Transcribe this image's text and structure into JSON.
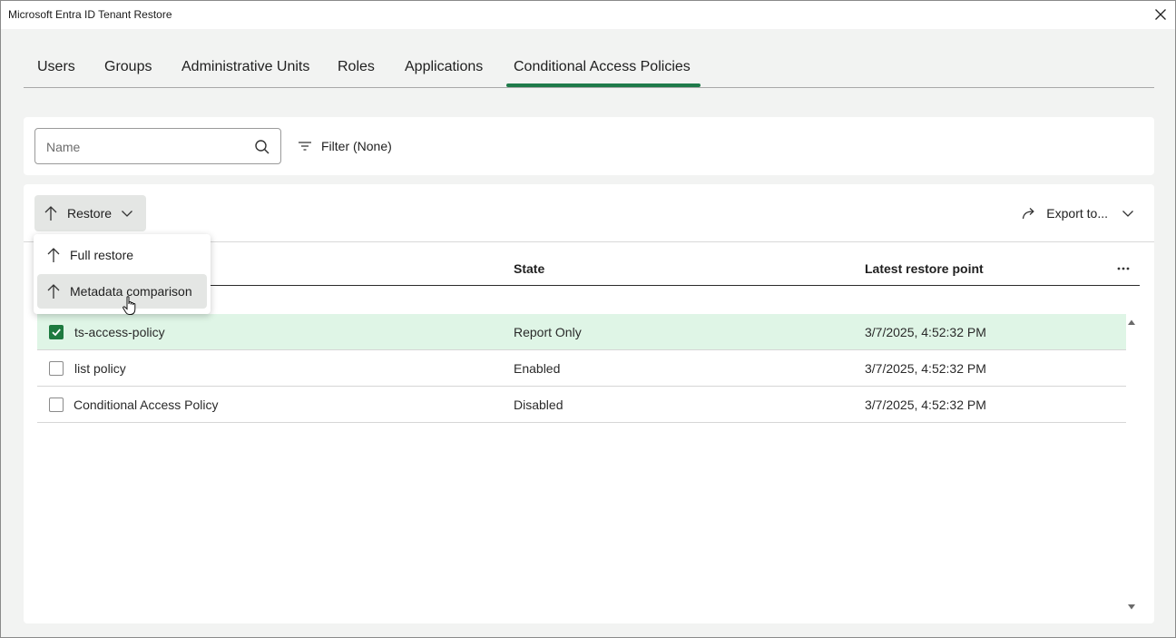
{
  "window": {
    "title": "Microsoft Entra ID Tenant Restore"
  },
  "tabs": [
    {
      "label": "Users"
    },
    {
      "label": "Groups"
    },
    {
      "label": "Administrative Units"
    },
    {
      "label": "Roles"
    },
    {
      "label": "Applications"
    },
    {
      "label": "Conditional Access Policies",
      "active": true
    }
  ],
  "search": {
    "placeholder": "Name",
    "value": ""
  },
  "filter": {
    "label": "Filter (None)"
  },
  "toolbar": {
    "restore_label": "Restore",
    "export_label": "Export to..."
  },
  "restore_menu": [
    {
      "label": "Full restore",
      "icon": "arrow-up-icon"
    },
    {
      "label": "Metadata comparison",
      "icon": "arrow-up-icon",
      "hovered": true
    }
  ],
  "table": {
    "columns": [
      "State",
      "Latest restore point"
    ],
    "rows": [
      {
        "checked": true,
        "name": "ts-access-policy",
        "state": "Report Only",
        "restore_point": "3/7/2025, 4:52:32 PM"
      },
      {
        "checked": false,
        "name": "list policy",
        "state": "Enabled",
        "restore_point": "3/7/2025, 4:52:32 PM"
      },
      {
        "checked": false,
        "name": "Conditional Access Policy",
        "state": "Disabled",
        "restore_point": "3/7/2025, 4:52:32 PM"
      }
    ]
  },
  "colors": {
    "accent": "#1f7a4a",
    "selected_row": "#dff5e6",
    "checkbox_on": "#1d7a3f"
  }
}
